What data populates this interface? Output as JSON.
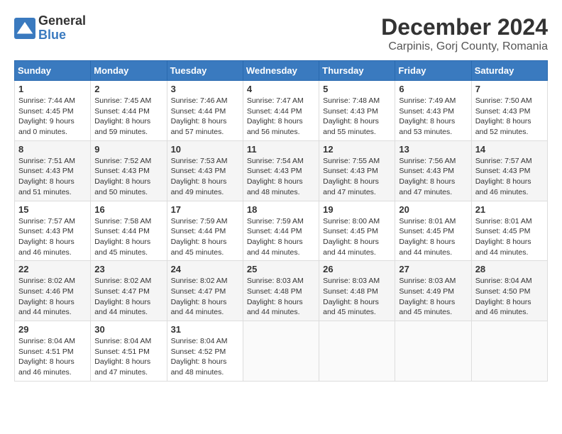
{
  "header": {
    "logo_general": "General",
    "logo_blue": "Blue",
    "month_title": "December 2024",
    "location": "Carpinis, Gorj County, Romania"
  },
  "days_of_week": [
    "Sunday",
    "Monday",
    "Tuesday",
    "Wednesday",
    "Thursday",
    "Friday",
    "Saturday"
  ],
  "weeks": [
    [
      {
        "day": "1",
        "info": "Sunrise: 7:44 AM\nSunset: 4:45 PM\nDaylight: 9 hours\nand 0 minutes."
      },
      {
        "day": "2",
        "info": "Sunrise: 7:45 AM\nSunset: 4:44 PM\nDaylight: 8 hours\nand 59 minutes."
      },
      {
        "day": "3",
        "info": "Sunrise: 7:46 AM\nSunset: 4:44 PM\nDaylight: 8 hours\nand 57 minutes."
      },
      {
        "day": "4",
        "info": "Sunrise: 7:47 AM\nSunset: 4:44 PM\nDaylight: 8 hours\nand 56 minutes."
      },
      {
        "day": "5",
        "info": "Sunrise: 7:48 AM\nSunset: 4:43 PM\nDaylight: 8 hours\nand 55 minutes."
      },
      {
        "day": "6",
        "info": "Sunrise: 7:49 AM\nSunset: 4:43 PM\nDaylight: 8 hours\nand 53 minutes."
      },
      {
        "day": "7",
        "info": "Sunrise: 7:50 AM\nSunset: 4:43 PM\nDaylight: 8 hours\nand 52 minutes."
      }
    ],
    [
      {
        "day": "8",
        "info": "Sunrise: 7:51 AM\nSunset: 4:43 PM\nDaylight: 8 hours\nand 51 minutes."
      },
      {
        "day": "9",
        "info": "Sunrise: 7:52 AM\nSunset: 4:43 PM\nDaylight: 8 hours\nand 50 minutes."
      },
      {
        "day": "10",
        "info": "Sunrise: 7:53 AM\nSunset: 4:43 PM\nDaylight: 8 hours\nand 49 minutes."
      },
      {
        "day": "11",
        "info": "Sunrise: 7:54 AM\nSunset: 4:43 PM\nDaylight: 8 hours\nand 48 minutes."
      },
      {
        "day": "12",
        "info": "Sunrise: 7:55 AM\nSunset: 4:43 PM\nDaylight: 8 hours\nand 47 minutes."
      },
      {
        "day": "13",
        "info": "Sunrise: 7:56 AM\nSunset: 4:43 PM\nDaylight: 8 hours\nand 47 minutes."
      },
      {
        "day": "14",
        "info": "Sunrise: 7:57 AM\nSunset: 4:43 PM\nDaylight: 8 hours\nand 46 minutes."
      }
    ],
    [
      {
        "day": "15",
        "info": "Sunrise: 7:57 AM\nSunset: 4:43 PM\nDaylight: 8 hours\nand 46 minutes."
      },
      {
        "day": "16",
        "info": "Sunrise: 7:58 AM\nSunset: 4:44 PM\nDaylight: 8 hours\nand 45 minutes."
      },
      {
        "day": "17",
        "info": "Sunrise: 7:59 AM\nSunset: 4:44 PM\nDaylight: 8 hours\nand 45 minutes."
      },
      {
        "day": "18",
        "info": "Sunrise: 7:59 AM\nSunset: 4:44 PM\nDaylight: 8 hours\nand 44 minutes."
      },
      {
        "day": "19",
        "info": "Sunrise: 8:00 AM\nSunset: 4:45 PM\nDaylight: 8 hours\nand 44 minutes."
      },
      {
        "day": "20",
        "info": "Sunrise: 8:01 AM\nSunset: 4:45 PM\nDaylight: 8 hours\nand 44 minutes."
      },
      {
        "day": "21",
        "info": "Sunrise: 8:01 AM\nSunset: 4:45 PM\nDaylight: 8 hours\nand 44 minutes."
      }
    ],
    [
      {
        "day": "22",
        "info": "Sunrise: 8:02 AM\nSunset: 4:46 PM\nDaylight: 8 hours\nand 44 minutes."
      },
      {
        "day": "23",
        "info": "Sunrise: 8:02 AM\nSunset: 4:47 PM\nDaylight: 8 hours\nand 44 minutes."
      },
      {
        "day": "24",
        "info": "Sunrise: 8:02 AM\nSunset: 4:47 PM\nDaylight: 8 hours\nand 44 minutes."
      },
      {
        "day": "25",
        "info": "Sunrise: 8:03 AM\nSunset: 4:48 PM\nDaylight: 8 hours\nand 44 minutes."
      },
      {
        "day": "26",
        "info": "Sunrise: 8:03 AM\nSunset: 4:48 PM\nDaylight: 8 hours\nand 45 minutes."
      },
      {
        "day": "27",
        "info": "Sunrise: 8:03 AM\nSunset: 4:49 PM\nDaylight: 8 hours\nand 45 minutes."
      },
      {
        "day": "28",
        "info": "Sunrise: 8:04 AM\nSunset: 4:50 PM\nDaylight: 8 hours\nand 46 minutes."
      }
    ],
    [
      {
        "day": "29",
        "info": "Sunrise: 8:04 AM\nSunset: 4:51 PM\nDaylight: 8 hours\nand 46 minutes."
      },
      {
        "day": "30",
        "info": "Sunrise: 8:04 AM\nSunset: 4:51 PM\nDaylight: 8 hours\nand 47 minutes."
      },
      {
        "day": "31",
        "info": "Sunrise: 8:04 AM\nSunset: 4:52 PM\nDaylight: 8 hours\nand 48 minutes."
      },
      {
        "day": "",
        "info": ""
      },
      {
        "day": "",
        "info": ""
      },
      {
        "day": "",
        "info": ""
      },
      {
        "day": "",
        "info": ""
      }
    ]
  ]
}
